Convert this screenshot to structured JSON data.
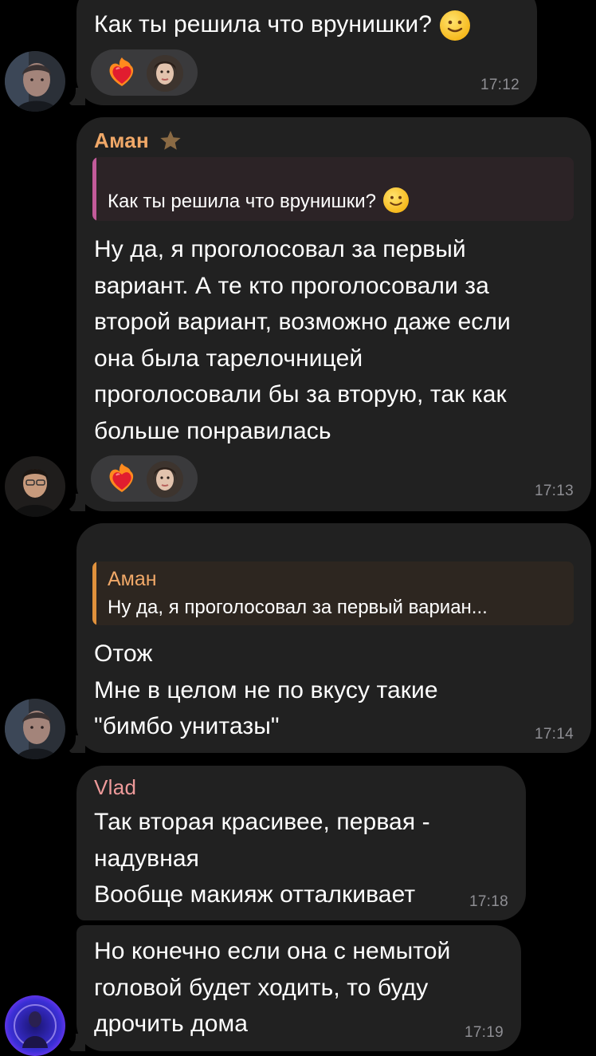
{
  "messages": [
    {
      "id": "m1",
      "text": "Как ты решила что врунишки?",
      "time": "17:12"
    },
    {
      "id": "m2",
      "sender": "Аман",
      "sender_color": "#f0a868",
      "reply_text": "Как ты решила что врунишки?",
      "reply_bar_color": "#c25b9a",
      "text": "Ну да, я проголосовал за первый\nвариант. А те кто проголосовали за\nвторой вариант, возможно даже если\nона была тарелочницей\nпроголосовали бы за вторую, так как\nбольше понравилась",
      "time": "17:13"
    },
    {
      "id": "m3",
      "reply_sender": "Аман",
      "reply_sender_color": "#f0a868",
      "reply_text": "Ну да, я проголосовал за первый вариан...",
      "reply_bar_color": "#e0913c",
      "text": "Отож\nМне в целом не по вкусу такие\n\"бимбо унитазы\"",
      "time": "17:14"
    },
    {
      "id": "m4",
      "sender": "Vlad",
      "sender_color": "#ee9a9a",
      "text": "Так вторая красивее, первая -\nнадувная\nВообще макияж отталкивает",
      "time": "17:18"
    },
    {
      "id": "m5",
      "text": "Но конечно если она с немытой\nголовой будет ходить, то буду\nдрочить дома",
      "time": "17:19"
    }
  ],
  "icons": {
    "reaction": "fire-heart-icon",
    "sender_badge": "star-icon"
  },
  "colors": {
    "background": "#000000",
    "bubble": "#212121",
    "reaction_pill": "#3a3a3c",
    "time": "#8e8e93"
  }
}
